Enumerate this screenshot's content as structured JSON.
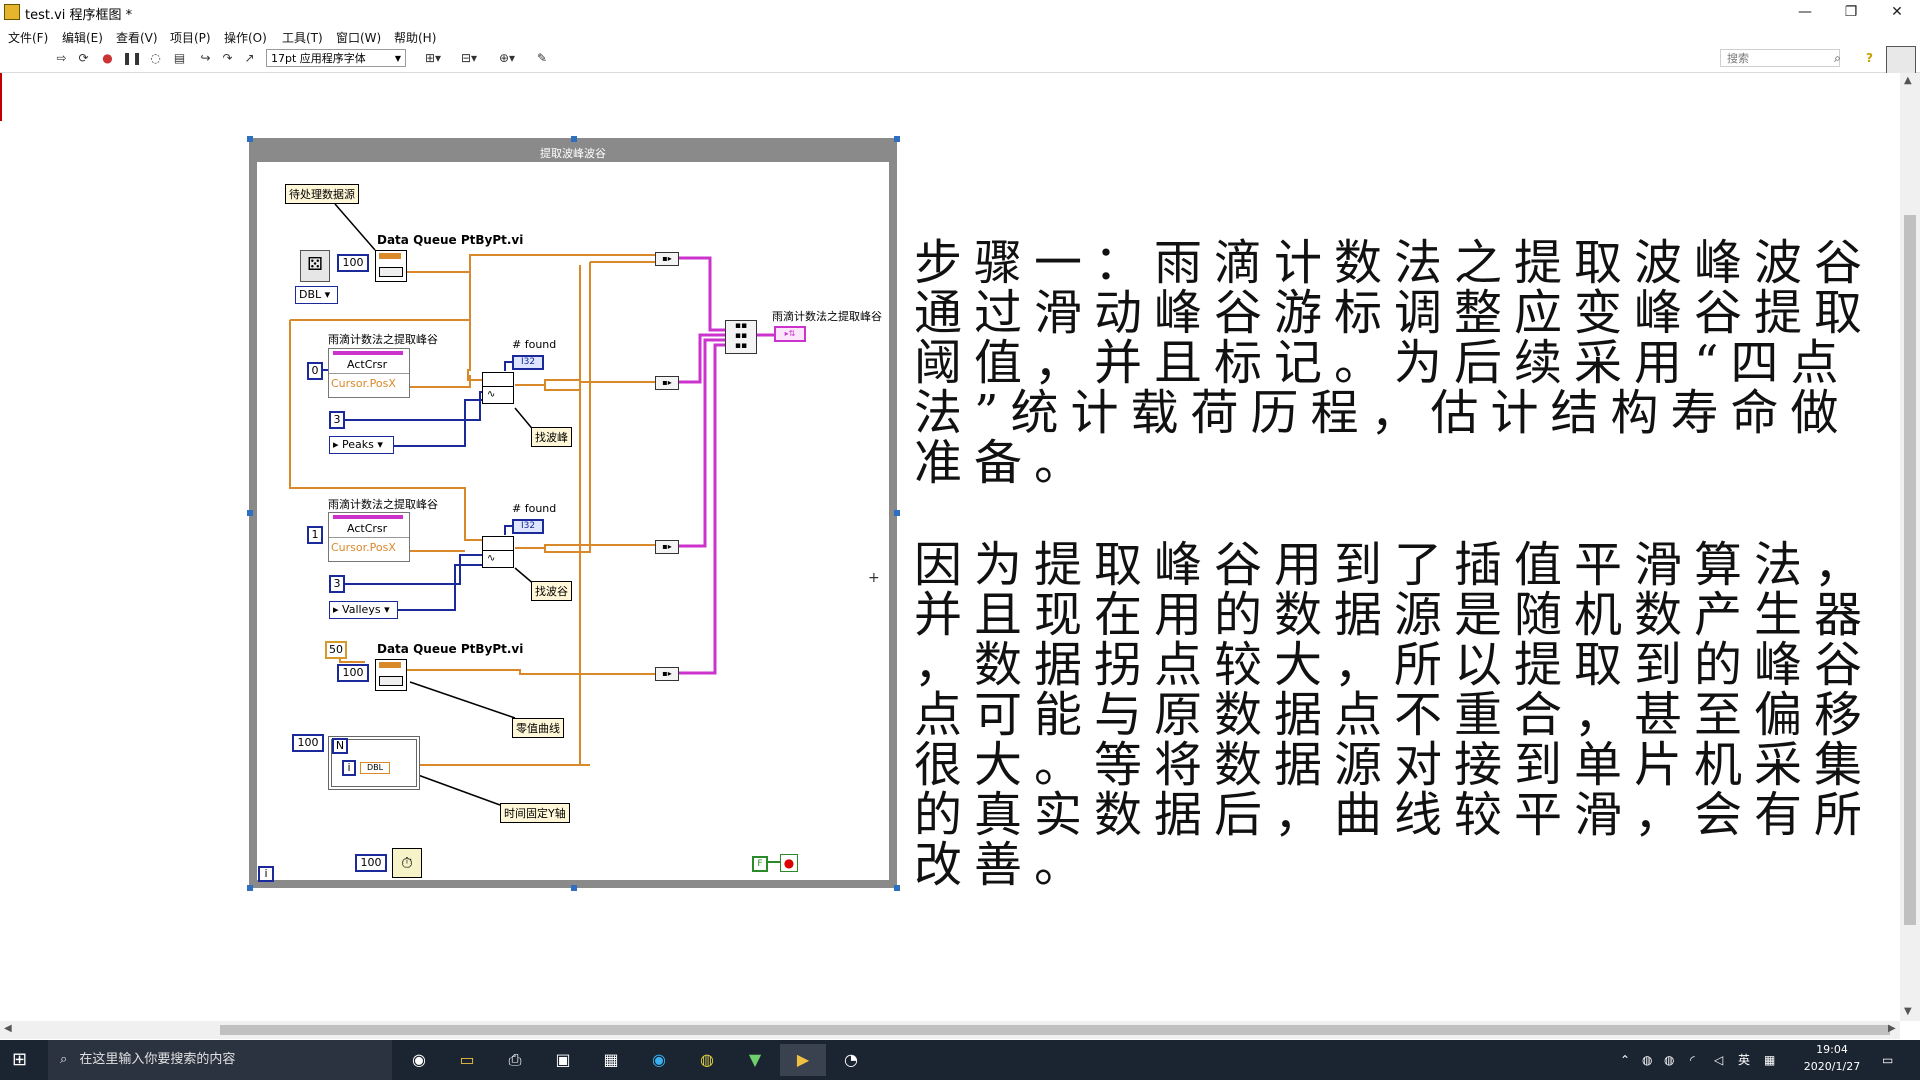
{
  "window": {
    "title": "test.vi 程序框图 *",
    "controls": [
      "—",
      "❐",
      "✕"
    ]
  },
  "menu": [
    "文件(F)",
    "编辑(E)",
    "查看(V)",
    "项目(P)",
    "操作(O)",
    "工具(T)",
    "窗口(W)",
    "帮助(H)"
  ],
  "toolbar": {
    "font_selector": "17pt 应用程序字体",
    "search_placeholder": "搜索",
    "help": "?"
  },
  "diagram": {
    "loop_title": "提取波峰波谷",
    "source_label": "待处理数据源",
    "dq1_title": "Data Queue PtByPt.vi",
    "dq1_size": "100",
    "dbl_type": "DBL",
    "peaks_title": "雨滴计数法之提取峰谷",
    "peaks_index": "0",
    "actcrsr": "ActCrsr",
    "cursor_posx": "Cursor.PosX",
    "found": "# found",
    "i32": "I32",
    "peaks_width": "3",
    "peaks_mode": "Peaks",
    "find_peaks": "找波峰",
    "valleys_title": "雨滴计数法之提取峰谷",
    "valleys_index": "1",
    "valleys_width": "3",
    "valleys_mode": "Valleys",
    "find_valleys": "找波谷",
    "const50": "50",
    "dq2_title": "Data Queue PtByPt.vi",
    "dq2_size": "100",
    "zero_curve": "零值曲线",
    "for_count": "100",
    "for_N": "N",
    "for_i": "i",
    "for_dbl": "DBL",
    "time_fix": "时间固定Y轴",
    "wait_ms": "100",
    "loop_i": "i",
    "stop_false": "F",
    "graph_label": "雨滴计数法之提取峰谷"
  },
  "notes": {
    "para1_lines": [
      "步骤一：雨滴计数法之提取波峰波谷",
      "通过滑动峰谷游标调整应变峰谷提取",
      "阈值，并且标记。为后续采用“四点",
      "法”统计载荷历程，估计结构寿命做",
      "准备。"
    ],
    "para2_lines": [
      "因为提取峰谷用到了插值平滑算法，",
      "并且现在用的数据源是随机数产生器",
      "，数据拐点较大，所以提取到的峰谷",
      "点可能与原数据点不重合，甚至偏移",
      "很大。等将数据源对接到单片机采集",
      "的真实数据后，曲线较平滑，会有所",
      "改善。"
    ]
  },
  "taskbar": {
    "search_placeholder": "在这里输入你要搜索的内容",
    "ime": "英",
    "time": "19:04",
    "date": "2020/1/27"
  },
  "colors": {
    "orange_wire": "#d9892a",
    "blue_wire": "#1a2a9a",
    "pink_wire": "#cc33cc",
    "loop_border": "#8a8a8a",
    "taskbar": "#1b2431"
  }
}
